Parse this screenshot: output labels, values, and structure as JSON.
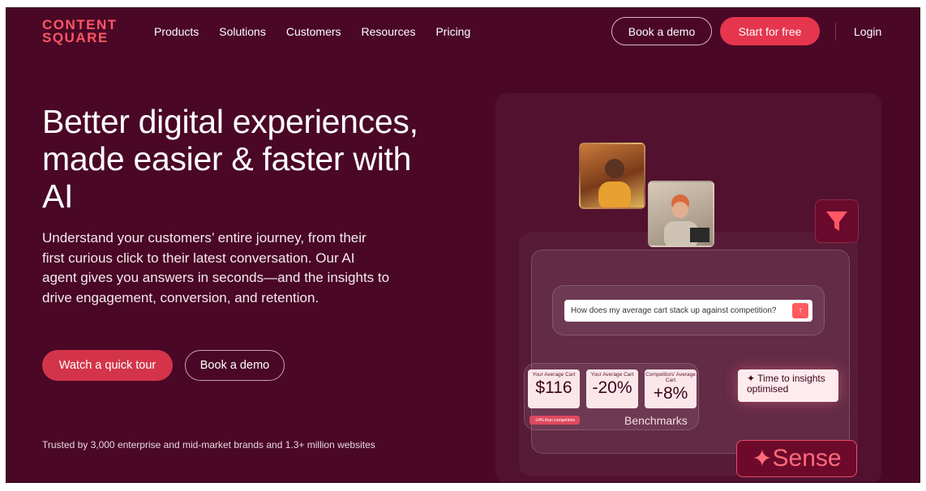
{
  "brand": {
    "logo_line1": "CONTENT",
    "logo_line2": "SQUARE"
  },
  "nav": {
    "items": [
      "Products",
      "Solutions",
      "Customers",
      "Resources",
      "Pricing"
    ]
  },
  "header": {
    "book_demo": "Book a demo",
    "start_free": "Start for free",
    "login": "Login"
  },
  "hero": {
    "title": "Better digital experiences, made easier & faster with AI",
    "lead": "Understand your customers’ entire journey, from their first curious click to their latest conversation. Our AI agent gives you answers in seconds—and the insights to drive engagement, conversion, and retention.",
    "cta_primary": "Watch a quick tour",
    "cta_secondary": "Book a demo",
    "trust": "Trusted by 3,000 enterprise and mid-market brands and 1.3+ million websites"
  },
  "visual": {
    "query": "How does my average cart stack up against competition?",
    "stats": [
      {
        "label": "Your Average Cart",
        "value": "$116"
      },
      {
        "label": "Your Average Cart",
        "value": "-20%"
      },
      {
        "label": "Competitors' Average Cart",
        "value": "+8%"
      }
    ],
    "badge": "-14% than competitors",
    "benchmarks": "Benchmarks",
    "insight": "Time to insights optimised",
    "sense": "Sense"
  },
  "colors": {
    "bg": "#4a0726",
    "accent": "#e5364e",
    "logo": "#ff5766"
  },
  "icons": [
    "funnel-icon",
    "send-arrow-icon",
    "sparkle-icon"
  ]
}
